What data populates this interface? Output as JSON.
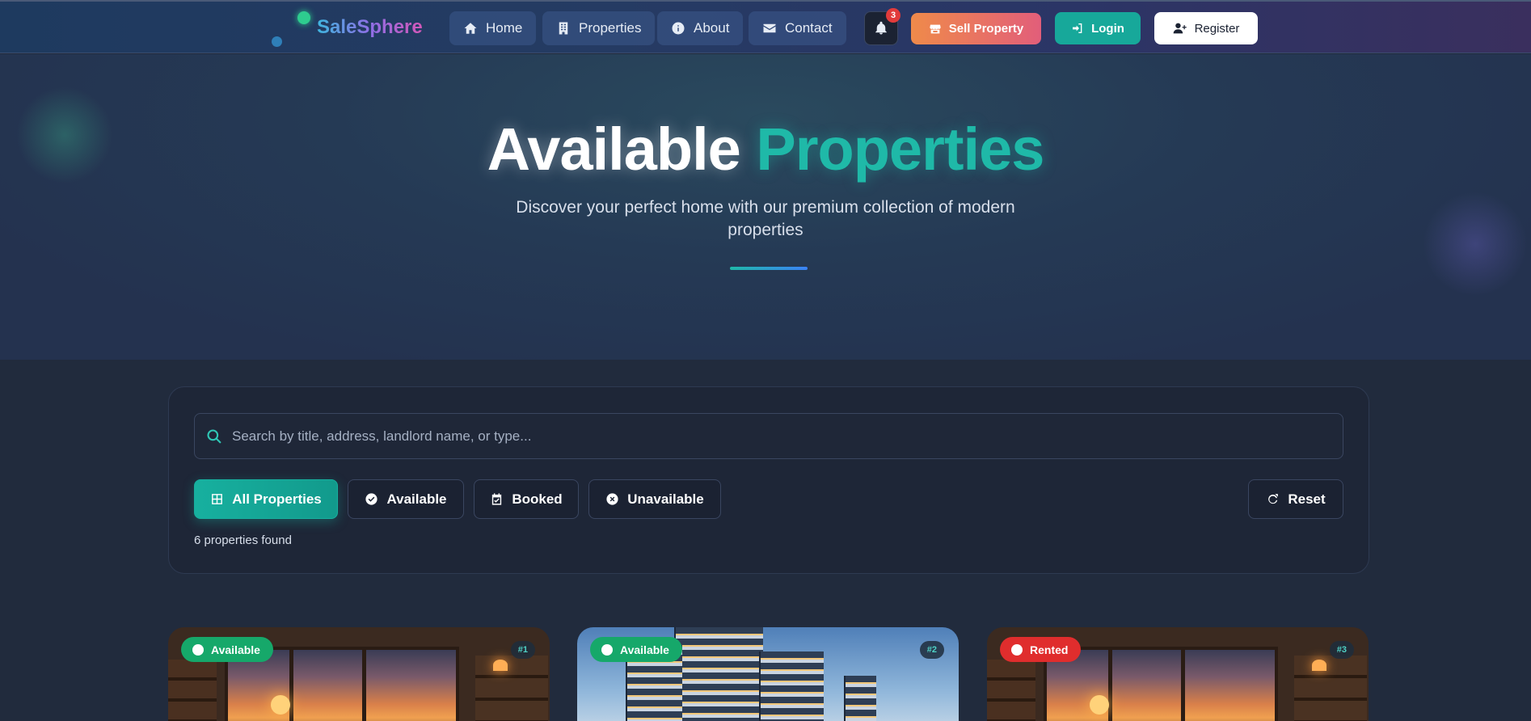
{
  "brand": {
    "name": "SaleSphere"
  },
  "nav": {
    "links": [
      {
        "label": "Home",
        "icon": "home-icon"
      },
      {
        "label": "Properties",
        "icon": "building-icon"
      },
      {
        "label": "About",
        "icon": "info-icon"
      },
      {
        "label": "Contact",
        "icon": "envelope-icon"
      }
    ],
    "notifications_count": "3",
    "sell_label": "Sell Property",
    "login_label": "Login",
    "register_label": "Register"
  },
  "hero": {
    "title_part1": "Available",
    "title_part2": "Properties",
    "subtitle": "Discover your perfect home with our premium collection of modern properties"
  },
  "filters": {
    "search_placeholder": "Search by title, address, landlord name, or type...",
    "search_value": "",
    "buttons": [
      {
        "label": "All Properties",
        "icon": "grid-icon",
        "active": true
      },
      {
        "label": "Available",
        "icon": "check-circle-icon",
        "active": false
      },
      {
        "label": "Booked",
        "icon": "calendar-check-icon",
        "active": false
      },
      {
        "label": "Unavailable",
        "icon": "x-circle-icon",
        "active": false
      }
    ],
    "reset_label": "Reset",
    "results_text": "6 properties found"
  },
  "properties": [
    {
      "status": "Available",
      "status_color": "#16a86a",
      "id_label": "#1",
      "image": "sunset-room"
    },
    {
      "status": "Available",
      "status_color": "#16a86a",
      "id_label": "#2",
      "image": "apartment-towers"
    },
    {
      "status": "Rented",
      "status_color": "#e02d2d",
      "id_label": "#3",
      "image": "sunset-room"
    }
  ],
  "colors": {
    "accent": "#1fb9a8",
    "background": "#212b3d",
    "sell_gradient_start": "#ef8a4a",
    "sell_gradient_end": "#e25e7a"
  }
}
